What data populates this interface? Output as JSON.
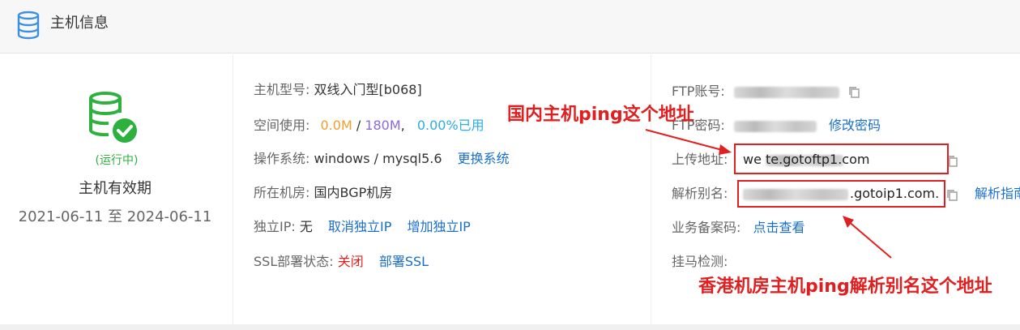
{
  "header": {
    "title": "主机信息",
    "icon": "database-icon"
  },
  "status": {
    "text": "(运行中)",
    "validity_label": "主机有效期",
    "validity_dates": "2021-06-11 至 2024-06-11",
    "color": "#2eb03f"
  },
  "host": {
    "model_label": "主机型号:",
    "model_value": "双线入门型[b068]",
    "space_label": "空间使用:",
    "space_used": "0.0M",
    "space_sep": " / ",
    "space_total": "180M",
    "space_comma": ",",
    "space_percent": "0.00%已用",
    "os_label": "操作系统:",
    "os_value": "windows / mysql5.6",
    "os_change_link": "更换系统",
    "room_label": "所在机房:",
    "room_value": "国内BGP机房",
    "ip_label": "独立IP:",
    "ip_value": "无",
    "ip_cancel_link": "取消独立IP",
    "ip_add_link": "增加独立IP",
    "ssl_label": "SSL部署状态:",
    "ssl_value": "关闭",
    "ssl_deploy_link": "部署SSL"
  },
  "ftp": {
    "account_label": "FTP账号:",
    "password_label": "FTP密码:",
    "change_password_link": "修改密码",
    "upload_label": "上传地址:",
    "upload_value": "we                  te.gotoftp1.com",
    "alias_label": "解析别名:",
    "alias_value": ".gotoip1.com.",
    "alias_help_link": "解析指南",
    "icp_label": "业务备案码:",
    "icp_link": "点击查看",
    "malware_label": "挂马检测:"
  },
  "annotations": {
    "domestic": "国内主机ping这个地址",
    "hongkong": "香港机房主机ping解析别名这个地址",
    "color": "#e02020"
  }
}
